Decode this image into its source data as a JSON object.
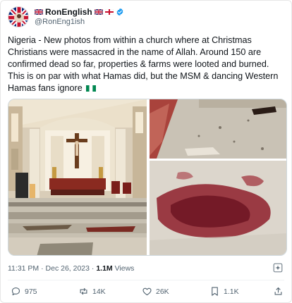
{
  "tweet": {
    "display_name": "RonEnglish",
    "handle": "@RonEng1ish",
    "text": "Nigeria - New photos from within a church where at Christmas Christians were massacred in the name of Allah. Around 150 are confirmed dead so far, properties & farms were looted and burned. This is on par with what Hamas did, but the MSM & dancing Western Hamas fans ignore",
    "time": "11:31 PM",
    "date": "Dec 26, 2023",
    "views_count": "1.1M",
    "views_label": "Views",
    "separator": "·"
  },
  "actions": {
    "replies": "975",
    "reposts": "14K",
    "likes": "26K",
    "bookmarks": "1.1K"
  },
  "icons": {
    "verified": "verified-badge-icon",
    "reply": "reply-icon",
    "repost": "repost-icon",
    "like": "heart-icon",
    "bookmark": "bookmark-icon",
    "grok": "sparkle-icon"
  },
  "colors": {
    "verified": "#1d9bf0",
    "secondary_text": "#536471",
    "primary_text": "#0f1419"
  }
}
